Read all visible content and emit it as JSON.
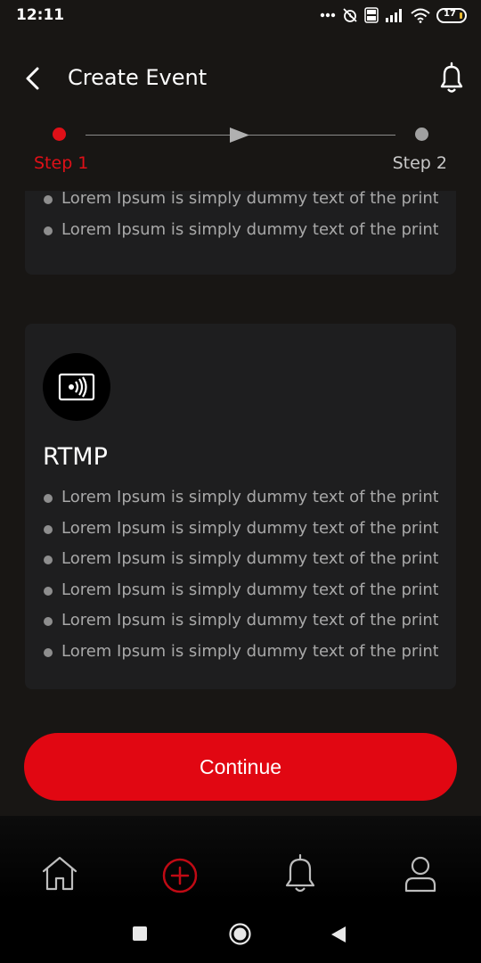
{
  "status_bar": {
    "time": "12:11",
    "battery_level": "17",
    "icons": [
      "more-dots-icon",
      "alarm-off-icon",
      "volte-icon",
      "signal-icon",
      "wifi-icon",
      "battery-icon"
    ]
  },
  "header": {
    "title": "Create Event",
    "back_icon": "back-arrow-icon",
    "bell_icon": "bell-icon"
  },
  "stepper": {
    "step1_label": "Step 1",
    "step2_label": "Step 2",
    "active_step": 1,
    "colors": {
      "active": "#e01018",
      "inactive": "#a0a0a0"
    }
  },
  "cards": {
    "top": {
      "bullets": [
        "Lorem Ipsum is simply dummy text of the printin",
        "Lorem Ipsum is simply dummy text of the printin"
      ]
    },
    "rtmp": {
      "icon": "rtmp-stream-icon",
      "title": "RTMP",
      "bullets": [
        "Lorem Ipsum is simply dummy text of the printin",
        "Lorem Ipsum is simply dummy text of the printin",
        "Lorem Ipsum is simply dummy text of the printin",
        "Lorem Ipsum is simply dummy text of the printin",
        "Lorem Ipsum is simply dummy text of the printin",
        "Lorem Ipsum is simply dummy text of the printin"
      ]
    }
  },
  "continue_button": {
    "label": "Continue",
    "color": "#e10712"
  },
  "bottom_nav": {
    "items": [
      {
        "icon": "home-icon",
        "active": false
      },
      {
        "icon": "add-circle-icon",
        "active": true
      },
      {
        "icon": "bell-icon",
        "active": false
      },
      {
        "icon": "profile-icon",
        "active": false
      }
    ]
  },
  "system_nav": {
    "buttons": [
      "recents-icon",
      "home-circle-icon",
      "back-triangle-icon"
    ]
  }
}
